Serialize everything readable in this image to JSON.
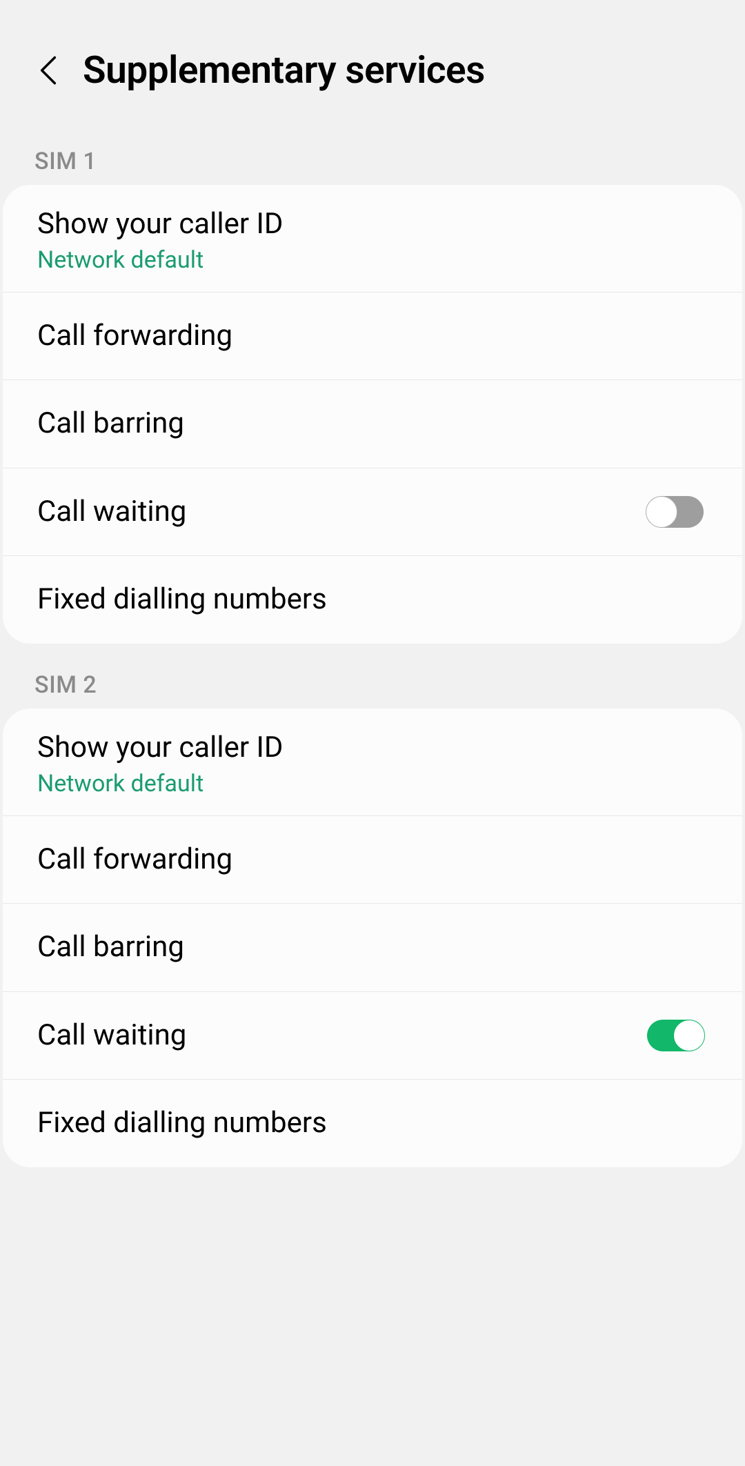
{
  "header": {
    "title": "Supplementary services"
  },
  "sections": [
    {
      "label": "SIM 1",
      "items": [
        {
          "title": "Show your caller ID",
          "subtitle": "Network default",
          "control": "none"
        },
        {
          "title": "Call forwarding",
          "control": "none"
        },
        {
          "title": "Call barring",
          "control": "none"
        },
        {
          "title": "Call waiting",
          "control": "switch",
          "value": "off"
        },
        {
          "title": "Fixed dialling numbers",
          "control": "none"
        }
      ]
    },
    {
      "label": "SIM 2",
      "items": [
        {
          "title": "Show your caller ID",
          "subtitle": "Network default",
          "control": "none"
        },
        {
          "title": "Call forwarding",
          "control": "none"
        },
        {
          "title": "Call barring",
          "control": "none"
        },
        {
          "title": "Call waiting",
          "control": "switch",
          "value": "on"
        },
        {
          "title": "Fixed dialling numbers",
          "control": "none"
        }
      ]
    }
  ]
}
